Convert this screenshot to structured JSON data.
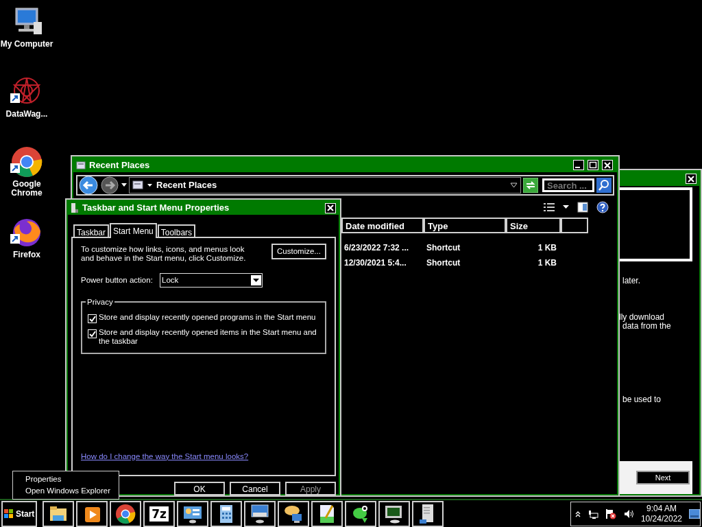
{
  "desktop_icons": [
    {
      "label": "My Computer",
      "kind": "computer",
      "shortcut": false
    },
    {
      "label": "DataWag...",
      "kind": "star",
      "shortcut": true
    },
    {
      "label": "Google Chrome",
      "kind": "ball",
      "shortcut": true
    },
    {
      "label": "Firefox",
      "kind": "fox",
      "shortcut": true
    }
  ],
  "background_window": {
    "paragraphs": [
      [
        "later."
      ],
      [
        "lly download",
        "data from the"
      ],
      [
        "be used to"
      ]
    ],
    "next_button": "Next"
  },
  "explorer": {
    "title": "Recent Places",
    "address": "Recent Places",
    "search_placeholder": "Search ...",
    "columns": [
      "Date modified",
      "Type",
      "Size"
    ],
    "rows": [
      [
        "6/23/2022 7:32 ...",
        "Shortcut",
        "1 KB"
      ],
      [
        "12/30/2021 5:4...",
        "Shortcut",
        "1 KB"
      ]
    ]
  },
  "dialog": {
    "title": "Taskbar and Start Menu Properties",
    "tabs": [
      {
        "label": "Taskbar",
        "selected": false
      },
      {
        "label": "Start Menu",
        "selected": true
      },
      {
        "label": "Toolbars",
        "selected": false
      }
    ],
    "description": "To customize how links, icons, and menus look and behave in the Start menu, click Customize.",
    "customize_button": "Customize...",
    "power_label": "Power button action:",
    "power_value": "Lock",
    "group_title": "Privacy",
    "options": [
      {
        "label": "Store and display recently opened programs in the Start menu",
        "checked": true
      },
      {
        "label": "Store and display recently opened items in the Start menu and the taskbar",
        "checked": true
      }
    ],
    "link": "How do I change the way the Start menu looks?",
    "buttons": [
      {
        "label": "OK",
        "disabled": false
      },
      {
        "label": "Cancel",
        "disabled": false
      },
      {
        "label": "Apply",
        "disabled": true
      }
    ]
  },
  "context_menu": [
    "Properties",
    "Open Windows Explorer"
  ],
  "taskbar": {
    "start": "Start",
    "apps": [
      {
        "kind": "folder"
      },
      {
        "kind": "media"
      },
      {
        "kind": "ball"
      },
      {
        "kind": "archive",
        "label": "7z"
      },
      {
        "kind": "panel"
      },
      {
        "kind": "calculator"
      },
      {
        "kind": "remote"
      },
      {
        "kind": "chat"
      },
      {
        "kind": "notepad"
      },
      {
        "kind": "lizard"
      },
      {
        "kind": "monitor"
      },
      {
        "kind": "server"
      }
    ],
    "time": "9:04 AM",
    "date": "10/24/2022"
  }
}
